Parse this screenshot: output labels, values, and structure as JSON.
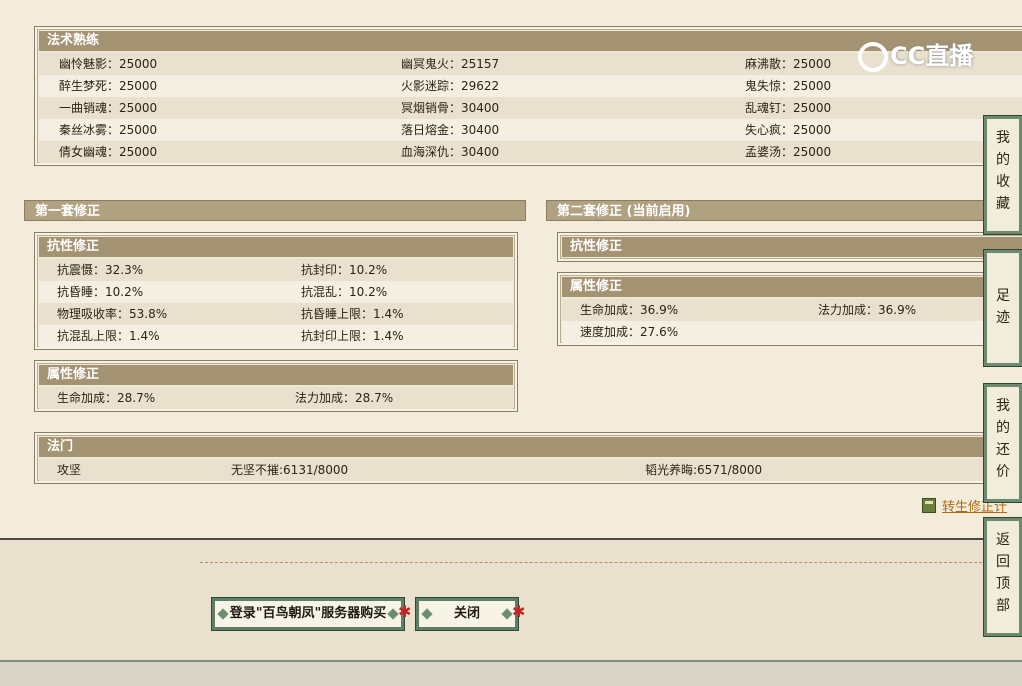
{
  "skills": {
    "title": "法术熟练",
    "rows": [
      [
        "幽怜魅影：25000",
        "幽冥鬼火：25157",
        "麻沸散：25000"
      ],
      [
        "醉生梦死：25000",
        "火影迷踪：29622",
        "鬼失惊：25000"
      ],
      [
        "一曲销魂：25000",
        "冥烟销骨：30400",
        "乱魂钉：25000"
      ],
      [
        "秦丝冰雾：25000",
        "落日熔金：30400",
        "失心疯：25000"
      ],
      [
        "倩女幽魂：25000",
        "血海深仇：30400",
        "孟婆汤：25000"
      ]
    ]
  },
  "set1": {
    "title": "第一套修正",
    "resist": {
      "title": "抗性修正",
      "rows": [
        [
          "抗震慑：32.3%",
          "抗封印：10.2%"
        ],
        [
          "抗昏睡：10.2%",
          "抗混乱：10.2%"
        ],
        [
          "物理吸收率：53.8%",
          "抗昏睡上限：1.4%"
        ],
        [
          "抗混乱上限：1.4%",
          "抗封印上限：1.4%"
        ]
      ]
    },
    "attr": {
      "title": "属性修正",
      "rows": [
        [
          "生命加成：28.7%",
          "法力加成：28.7%"
        ]
      ]
    }
  },
  "set2": {
    "title": "第二套修正 (当前启用)",
    "resist": {
      "title": "抗性修正"
    },
    "attr": {
      "title": "属性修正",
      "rows": [
        [
          "生命加成：36.9%",
          "法力加成：36.9%"
        ],
        [
          "速度加成：27.6%",
          ""
        ]
      ]
    }
  },
  "famen": {
    "title": "法门",
    "row": [
      "攻坚",
      "无坚不摧:6131/8000",
      "韬光养晦:6571/8000"
    ]
  },
  "link": {
    "label": "转生修正计"
  },
  "buttons": {
    "buy": "登录\"百鸟朝凤\"服务器购买",
    "close": "关闭"
  },
  "side_tabs": [
    [
      "我",
      "的",
      "收",
      "藏"
    ],
    [
      "足",
      "迹"
    ],
    [
      "我",
      "的",
      "还",
      "价"
    ],
    [
      "返",
      "回",
      "顶",
      "部"
    ]
  ],
  "watermark": "CC直播",
  "colors": {
    "header": "#a49373",
    "accent_link": "#b06a12",
    "frame_green": "#5f7e66",
    "ribbon_red": "#c62222"
  }
}
